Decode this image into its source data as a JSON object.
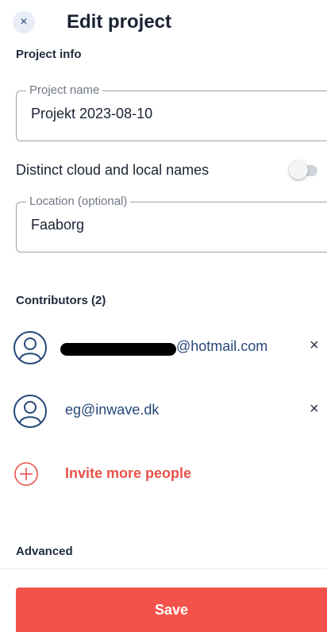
{
  "header": {
    "close_glyph": "×",
    "title": "Edit project"
  },
  "project_info": {
    "section_label": "Project info",
    "name_field": {
      "label": "Project name",
      "value": "Projekt 2023-08-10"
    },
    "distinct_names": {
      "label": "Distinct cloud and local names",
      "enabled": false
    },
    "location_field": {
      "label": "Location (optional)",
      "value": "Faaborg"
    }
  },
  "contributors": {
    "section_label": "Contributors (2)",
    "items": [
      {
        "email": "@hotmail.com",
        "redacted_prefix": true,
        "remove_glyph": "×"
      },
      {
        "email": "eg@inwave.dk",
        "redacted_prefix": false,
        "remove_glyph": "×"
      }
    ],
    "invite_label": "Invite more people"
  },
  "advanced": {
    "section_label": "Advanced"
  },
  "footer": {
    "save_label": "Save"
  },
  "icons": {
    "close": "close-icon",
    "avatar": "user-avatar-icon",
    "remove": "remove-icon",
    "invite": "plus-circle-icon"
  },
  "colors": {
    "accent": "#f2524a",
    "invite_text": "#e5534b",
    "link_text": "#27487a",
    "close_bg": "#e8edf6"
  }
}
